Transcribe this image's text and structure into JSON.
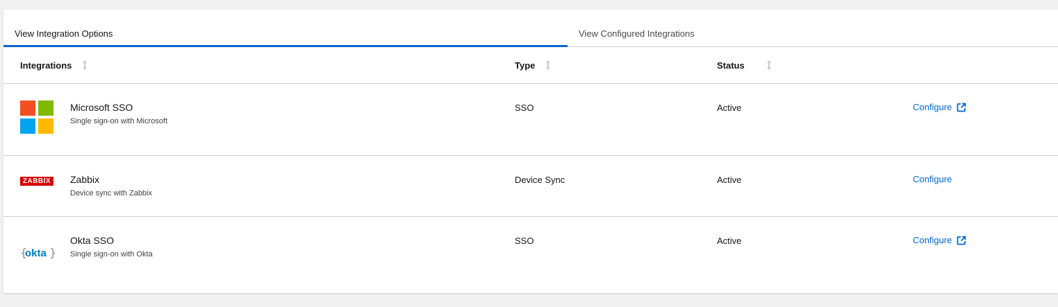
{
  "tabs": [
    {
      "label": "View Integration Options",
      "active": true
    },
    {
      "label": "View Configured Integrations",
      "active": false
    }
  ],
  "table": {
    "columns": [
      "Integrations",
      "Type",
      "Status"
    ],
    "rows": [
      {
        "name": "Microsoft SSO",
        "description": "Single sign-on with Microsoft",
        "type": "SSO",
        "status": "Active",
        "action": "Configure",
        "action_icon": "external-link-icon",
        "logo": "microsoft-logo"
      },
      {
        "name": "Zabbix",
        "description": "Device sync with Zabbix",
        "type": "Device Sync",
        "status": "Active",
        "action": "Configure",
        "action_icon": null,
        "logo": "zabbix-logo",
        "logo_text": "ZABBIX"
      },
      {
        "name": "Okta SSO",
        "description": "Single sign-on with Okta",
        "type": "SSO",
        "status": "Active",
        "action": "Configure",
        "action_icon": "external-link-icon",
        "logo": "okta-logo",
        "logo_text": "okta"
      }
    ]
  },
  "colors": {
    "accent": "#0066cc",
    "microsoft": [
      "#f25022",
      "#7fba00",
      "#00a4ef",
      "#ffb900"
    ],
    "zabbix": "#d40000",
    "okta": "#007dc1"
  }
}
